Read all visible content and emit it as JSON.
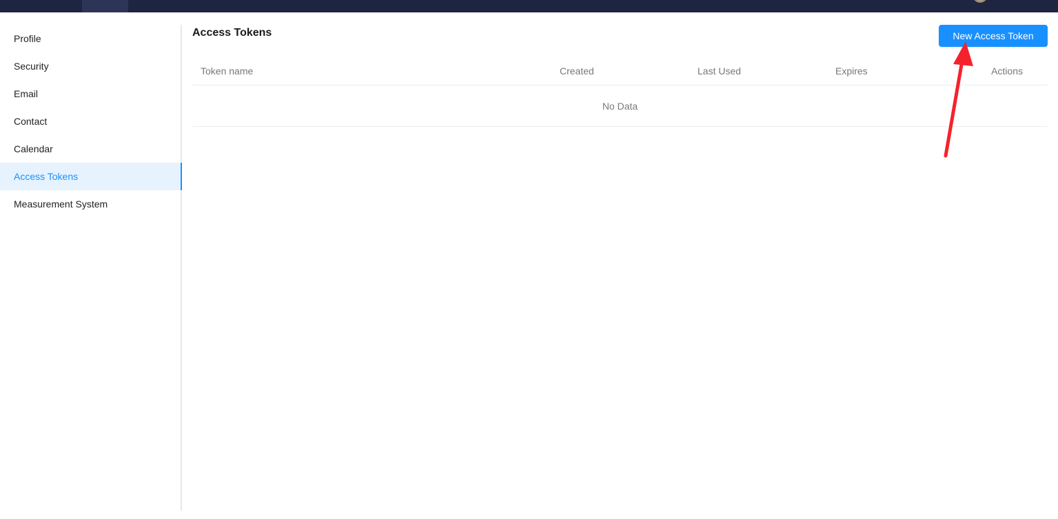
{
  "sidebar": {
    "items": [
      {
        "label": "Profile",
        "active": false
      },
      {
        "label": "Security",
        "active": false
      },
      {
        "label": "Email",
        "active": false
      },
      {
        "label": "Contact",
        "active": false
      },
      {
        "label": "Calendar",
        "active": false
      },
      {
        "label": "Access Tokens",
        "active": true
      },
      {
        "label": "Measurement System",
        "active": false
      }
    ]
  },
  "main": {
    "title": "Access Tokens",
    "new_token_label": "New Access Token",
    "table": {
      "columns": [
        "Token name",
        "Created",
        "Last Used",
        "Expires",
        "Actions"
      ],
      "rows": [],
      "empty_text": "No Data"
    }
  },
  "colors": {
    "topbar": "#1e2540",
    "accent": "#1890ff",
    "active_bg": "#e6f2fd",
    "annotation_arrow": "#f5222d"
  }
}
